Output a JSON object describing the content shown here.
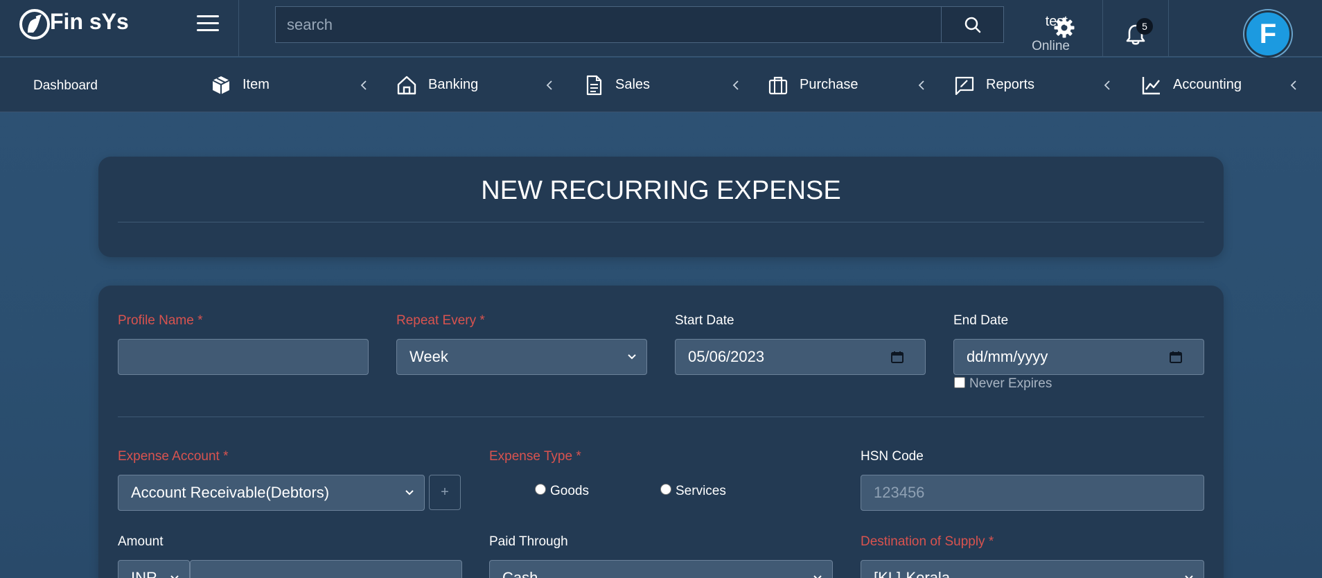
{
  "app": {
    "name": "Fin sYs"
  },
  "header": {
    "search_placeholder": "search",
    "notifications_count": "5",
    "user_name": "test",
    "user_status": "Online",
    "avatar_letter": "F"
  },
  "nav": {
    "dashboard": "Dashboard",
    "items": [
      {
        "label": "Item",
        "icon": "box-icon"
      },
      {
        "label": "Banking",
        "icon": "home-icon"
      },
      {
        "label": "Sales",
        "icon": "document-icon"
      },
      {
        "label": "Purchase",
        "icon": "briefcase-icon"
      },
      {
        "label": "Reports",
        "icon": "report-icon"
      },
      {
        "label": "Accounting",
        "icon": "chart-line-icon"
      }
    ]
  },
  "page": {
    "title": "NEW RECURRING EXPENSE"
  },
  "form": {
    "profile_name": {
      "label": "Profile Name *",
      "value": ""
    },
    "repeat_every": {
      "label": "Repeat Every *",
      "value": "Week"
    },
    "start_date": {
      "label": "Start Date",
      "value": "05/06/2023"
    },
    "end_date": {
      "label": "End Date",
      "placeholder": "dd/mm/yyyy"
    },
    "never_expires": {
      "label": "Never Expires",
      "checked": false
    },
    "expense_account": {
      "label": "Expense Account *",
      "value": "Account Receivable(Debtors)",
      "add_label": "+"
    },
    "expense_type": {
      "label": "Expense Type *",
      "options": [
        "Goods",
        "Services"
      ]
    },
    "hsn_code": {
      "label": "HSN Code",
      "placeholder": "123456"
    },
    "amount": {
      "label": "Amount",
      "currency": "INR",
      "value": ""
    },
    "paid_through": {
      "label": "Paid Through",
      "value": "Cash"
    },
    "destination_of_supply": {
      "label": "Destination of Supply *",
      "value": "[KL]-Kerala"
    }
  },
  "colors": {
    "required_label": "#d9534f",
    "header_bg": "#233a53",
    "page_bg": "#2e5275",
    "field_bg": "#415a74",
    "avatar_bg": "#1c9ae0"
  }
}
